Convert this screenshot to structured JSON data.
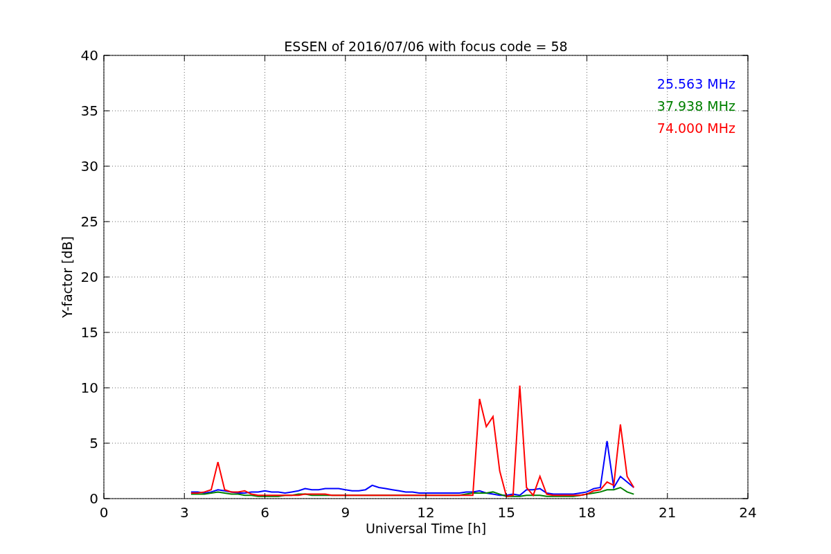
{
  "chart_data": {
    "type": "line",
    "grid": true,
    "title": "ESSEN of 2016/07/06 with focus code = 58",
    "xlabel": "Universal Time [h]",
    "ylabel": "Y-factor [dB]",
    "xlim": [
      0,
      24
    ],
    "ylim": [
      0,
      40
    ],
    "xticks": [
      0,
      3,
      6,
      9,
      12,
      15,
      18,
      21,
      24
    ],
    "yticks": [
      0,
      5,
      10,
      15,
      20,
      25,
      30,
      35,
      40
    ],
    "x": [
      3.25,
      3.5,
      3.75,
      4.0,
      4.25,
      4.5,
      4.75,
      5.0,
      5.25,
      5.5,
      5.75,
      6.0,
      6.25,
      6.5,
      6.75,
      7.0,
      7.25,
      7.5,
      7.75,
      8.0,
      8.25,
      8.5,
      8.75,
      9.0,
      9.25,
      9.5,
      9.75,
      10.0,
      10.25,
      10.5,
      10.75,
      11.0,
      11.25,
      11.5,
      11.75,
      12.0,
      12.25,
      12.5,
      12.75,
      13.0,
      13.25,
      13.5,
      13.75,
      14.0,
      14.25,
      14.5,
      14.75,
      15.0,
      15.25,
      15.5,
      15.75,
      16.0,
      16.25,
      16.5,
      16.75,
      17.0,
      17.25,
      17.5,
      17.75,
      18.0,
      18.25,
      18.5,
      18.75,
      19.0,
      19.25,
      19.5,
      19.75
    ],
    "series": [
      {
        "name": "25.563 MHz",
        "color": "#0000ff",
        "values": [
          0.6,
          0.6,
          0.5,
          0.6,
          0.8,
          0.7,
          0.6,
          0.5,
          0.5,
          0.6,
          0.6,
          0.7,
          0.6,
          0.6,
          0.5,
          0.6,
          0.7,
          0.9,
          0.8,
          0.8,
          0.9,
          0.9,
          0.9,
          0.8,
          0.7,
          0.7,
          0.8,
          1.2,
          1.0,
          0.9,
          0.8,
          0.7,
          0.6,
          0.6,
          0.5,
          0.5,
          0.5,
          0.5,
          0.5,
          0.5,
          0.5,
          0.6,
          0.6,
          0.7,
          0.5,
          0.4,
          0.3,
          0.3,
          0.4,
          0.3,
          0.8,
          0.8,
          0.9,
          0.5,
          0.4,
          0.4,
          0.4,
          0.4,
          0.5,
          0.6,
          0.9,
          1.0,
          5.2,
          1.0,
          2.0,
          1.5,
          1.0
        ]
      },
      {
        "name": "37.938 MHz",
        "color": "#008000",
        "values": [
          0.4,
          0.4,
          0.4,
          0.5,
          0.6,
          0.5,
          0.4,
          0.4,
          0.3,
          0.3,
          0.2,
          0.2,
          0.2,
          0.2,
          0.3,
          0.3,
          0.4,
          0.4,
          0.3,
          0.3,
          0.3,
          0.3,
          0.3,
          0.3,
          0.3,
          0.3,
          0.3,
          0.3,
          0.3,
          0.3,
          0.3,
          0.3,
          0.3,
          0.3,
          0.3,
          0.3,
          0.3,
          0.3,
          0.3,
          0.3,
          0.3,
          0.4,
          0.5,
          0.5,
          0.5,
          0.6,
          0.4,
          0.2,
          0.2,
          0.2,
          0.3,
          0.3,
          0.3,
          0.2,
          0.2,
          0.2,
          0.2,
          0.2,
          0.3,
          0.4,
          0.5,
          0.6,
          0.8,
          0.8,
          1.0,
          0.6,
          0.4
        ]
      },
      {
        "name": "74.000 MHz",
        "color": "#ff0000",
        "values": [
          0.5,
          0.5,
          0.6,
          0.8,
          3.3,
          0.8,
          0.6,
          0.6,
          0.7,
          0.4,
          0.3,
          0.3,
          0.3,
          0.3,
          0.3,
          0.3,
          0.3,
          0.4,
          0.4,
          0.4,
          0.4,
          0.3,
          0.3,
          0.3,
          0.3,
          0.3,
          0.3,
          0.3,
          0.3,
          0.3,
          0.3,
          0.3,
          0.3,
          0.3,
          0.3,
          0.3,
          0.3,
          0.3,
          0.3,
          0.3,
          0.3,
          0.3,
          0.3,
          9.0,
          6.5,
          7.4,
          2.5,
          0.2,
          0.3,
          10.2,
          1.0,
          0.3,
          2.0,
          0.4,
          0.3,
          0.3,
          0.3,
          0.3,
          0.3,
          0.4,
          0.7,
          0.8,
          1.5,
          1.2,
          6.7,
          2.0,
          1.0
        ]
      }
    ]
  }
}
